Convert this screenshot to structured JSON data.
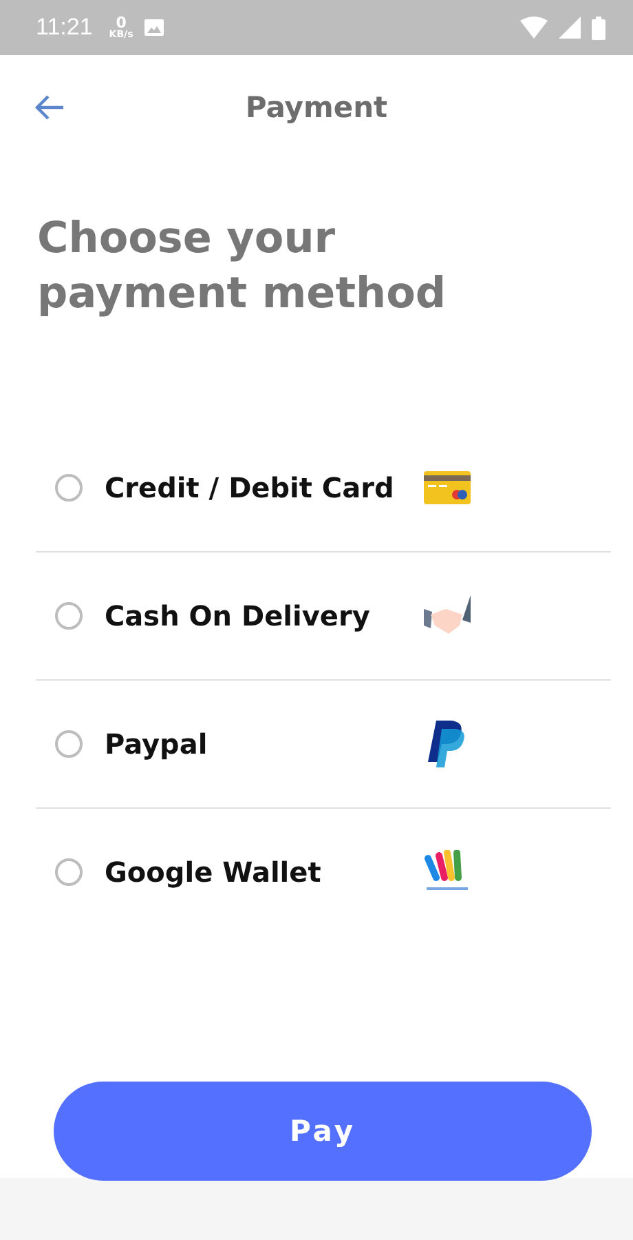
{
  "status_bar": {
    "time": "11:21",
    "net_speed": "0",
    "net_unit": "KB/s"
  },
  "header": {
    "title": "Payment"
  },
  "heading": "Choose your payment method",
  "options": [
    {
      "label": "Credit / Debit Card",
      "kind": "card",
      "selected": false
    },
    {
      "label": "Cash On Delivery",
      "kind": "cash",
      "selected": false
    },
    {
      "label": "Paypal",
      "kind": "paypal",
      "selected": false
    },
    {
      "label": "Google Wallet",
      "kind": "wallet",
      "selected": false
    }
  ],
  "pay_button": "Pay"
}
